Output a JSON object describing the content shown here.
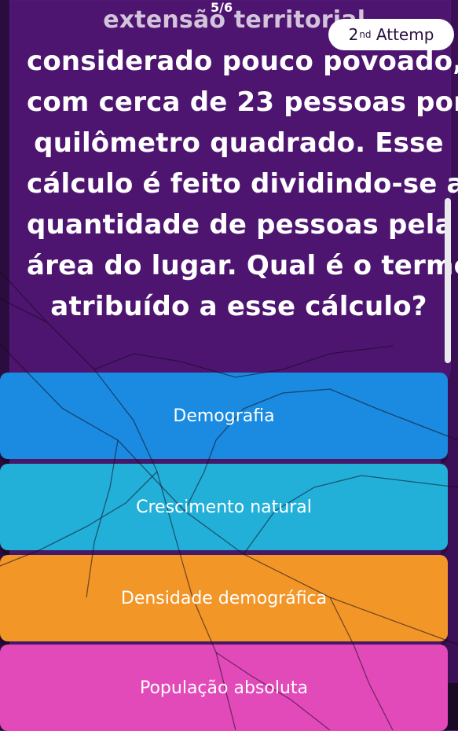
{
  "progress": {
    "text": "5/6"
  },
  "attempt": {
    "number": "2",
    "suffix": "nd",
    "word": "Attemp"
  },
  "question": {
    "lines": [
      "extensão territorial,",
      "considerado pouco povoado,",
      "com cerca de 23 pessoas por",
      "quilômetro quadrado. Esse",
      "cálculo é feito dividindo-se a",
      "quantidade de pessoas pela",
      "área do lugar. Qual é o termo",
      "atribuído a esse cálculo?"
    ]
  },
  "answers": [
    {
      "label": "Demografia"
    },
    {
      "label": "Crescimento natural"
    },
    {
      "label": "Densidade demográfica"
    },
    {
      "label": "População absoluta"
    }
  ],
  "colors": {
    "background": "#5a1f86",
    "card": "#4d1570",
    "answer_blue": "#1a8be0",
    "answer_cyan": "#22b0d9",
    "answer_orange": "#f29628",
    "answer_pink": "#e34ab9"
  }
}
